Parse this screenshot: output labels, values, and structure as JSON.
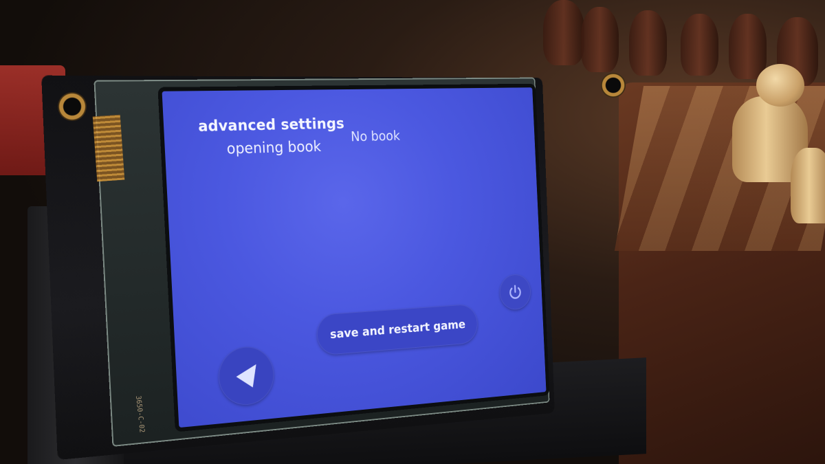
{
  "screen": {
    "title": "advanced settings",
    "setting_label": "opening book",
    "setting_value": "No book",
    "save_button_label": "save and restart game",
    "power_icon": "power-icon",
    "back_icon": "back-arrow-icon"
  },
  "device": {
    "pcb_marking": "3650-C-02"
  },
  "colors": {
    "screen_bg": "#4b58e0",
    "button_bg": "#3b46c6",
    "text": "#f4f6ff"
  }
}
